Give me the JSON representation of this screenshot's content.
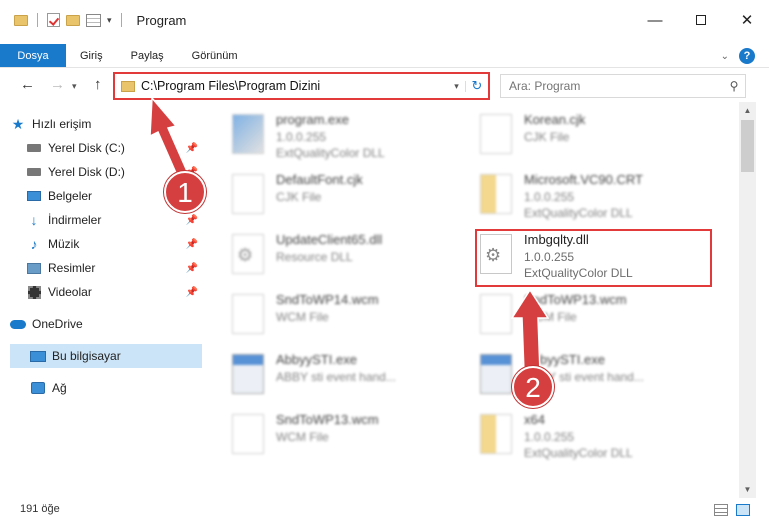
{
  "window": {
    "title": "Program",
    "minimize_glyph": "—",
    "close_glyph": "✕"
  },
  "ribbon": {
    "tabs": [
      "Dosya",
      "Giriş",
      "Paylaş",
      "Görünüm"
    ],
    "help_glyph": "?"
  },
  "address": {
    "path": "C:\\Program Files\\Program Dizini",
    "search_placeholder": "Ara: Program"
  },
  "nav": {
    "quick_access": "Hızlı erişim",
    "items": [
      {
        "label": "Yerel Disk (C:)",
        "icon": "drive-icon",
        "pinned": true
      },
      {
        "label": "Yerel Disk (D:)",
        "icon": "drive-icon",
        "pinned": true
      },
      {
        "label": "Belgeler",
        "icon": "documents-icon",
        "pinned": true
      },
      {
        "label": "İndirmeler",
        "icon": "download-icon",
        "pinned": true
      },
      {
        "label": "Müzik",
        "icon": "music-icon",
        "pinned": true
      },
      {
        "label": "Resimler",
        "icon": "pictures-icon",
        "pinned": true
      },
      {
        "label": "Videolar",
        "icon": "videos-icon",
        "pinned": true
      }
    ],
    "onedrive": "OneDrive",
    "this_pc": "Bu bilgisayar",
    "network": "Ağ"
  },
  "files": [
    {
      "name": "program.exe",
      "line2": "1.0.0.255",
      "line3": "ExtQualityColor DLL",
      "icon": "exe"
    },
    {
      "name": "Korean.cjk",
      "line2": "CJK File",
      "line3": "",
      "icon": "doc"
    },
    {
      "name": "DefaultFont.cjk",
      "line2": "CJK File",
      "line3": "",
      "icon": "doc"
    },
    {
      "name": "Microsoft.VC90.CRT",
      "line2": "1.0.0.255",
      "line3": "ExtQualityColor DLL",
      "icon": "folderish"
    },
    {
      "name": "UpdateClient65.dll",
      "line2": "Resource DLL",
      "line3": "",
      "icon": "gear"
    },
    {
      "name": "Imbgqlty.dll",
      "line2": "1.0.0.255",
      "line3": "ExtQualityColor DLL",
      "icon": "gear"
    },
    {
      "name": "SndToWP14.wcm",
      "line2": "WCM File",
      "line3": "",
      "icon": "doc"
    },
    {
      "name": "SndToWP13.wcm",
      "line2": "WCM File",
      "line3": "",
      "icon": "doc"
    },
    {
      "name": "AbbyySTI.exe",
      "line2": "ABBY sti event hand...",
      "line3": "",
      "icon": "app"
    },
    {
      "name": "AbbyySTI.exe",
      "line2": "ABBY sti event hand...",
      "line3": "",
      "icon": "app"
    },
    {
      "name": "SndToWP13.wcm",
      "line2": "WCM File",
      "line3": "",
      "icon": "doc"
    },
    {
      "name": "x64",
      "line2": "1.0.0.255",
      "line3": "ExtQualityColor DLL",
      "icon": "folderish"
    }
  ],
  "status": {
    "item_count": "191 öğe"
  },
  "annotations": {
    "step1": "1",
    "step2": "2",
    "color": "#d63f3f"
  }
}
